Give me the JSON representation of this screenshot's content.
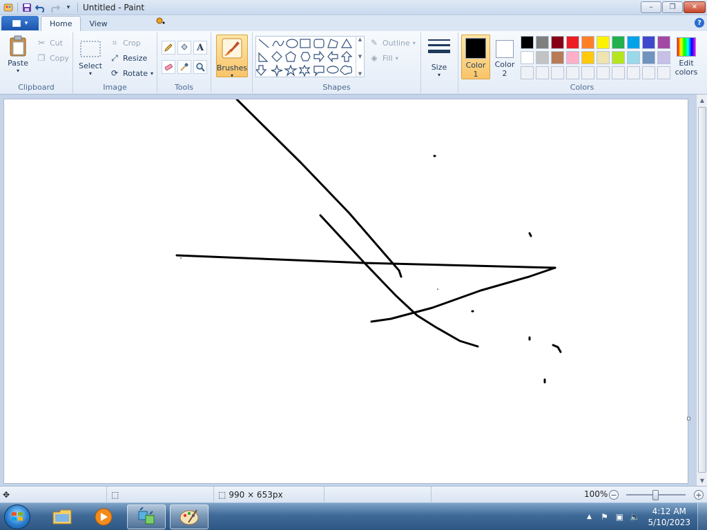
{
  "window": {
    "title": "Untitled - Paint",
    "minimize": "–",
    "maximize": "❐",
    "close": "✕"
  },
  "tabs": {
    "home": "Home",
    "view": "View"
  },
  "ribbon": {
    "clipboard": {
      "label": "Clipboard",
      "paste": "Paste",
      "cut": "Cut",
      "copy": "Copy"
    },
    "image": {
      "label": "Image",
      "select": "Select",
      "crop": "Crop",
      "resize": "Resize",
      "rotate": "Rotate"
    },
    "tools": {
      "label": "Tools",
      "text_glyph": "A"
    },
    "brushes": {
      "label": "Brushes"
    },
    "shapes": {
      "label": "Shapes",
      "outline": "Outline",
      "fill": "Fill"
    },
    "size": {
      "label": "Size"
    },
    "colors": {
      "label": "Colors",
      "color1": "Color",
      "color1_num": "1",
      "color2": "Color",
      "color2_num": "2",
      "edit": "Edit",
      "edit2": "colors",
      "color1_value": "#000000",
      "color2_value": "#ffffff",
      "palette_row1": [
        "#000000",
        "#7f7f7f",
        "#880015",
        "#ed1c24",
        "#ff7f27",
        "#fff200",
        "#22b14c",
        "#00a2e8",
        "#3f48cc",
        "#a349a4"
      ],
      "palette_row2": [
        "#ffffff",
        "#c3c3c3",
        "#b97a57",
        "#ffaec9",
        "#ffc90e",
        "#efe4b0",
        "#b5e61d",
        "#99d9ea",
        "#7092be",
        "#c8bfe7"
      ],
      "palette_row3": [
        "",
        "",
        "",
        "",
        "",
        "",
        "",
        "",
        "",
        ""
      ]
    }
  },
  "status": {
    "canvas_size": "990 × 653px",
    "zoom": "100%"
  },
  "taskbar": {
    "time": "4:12 AM",
    "date": "5/10/2023"
  }
}
